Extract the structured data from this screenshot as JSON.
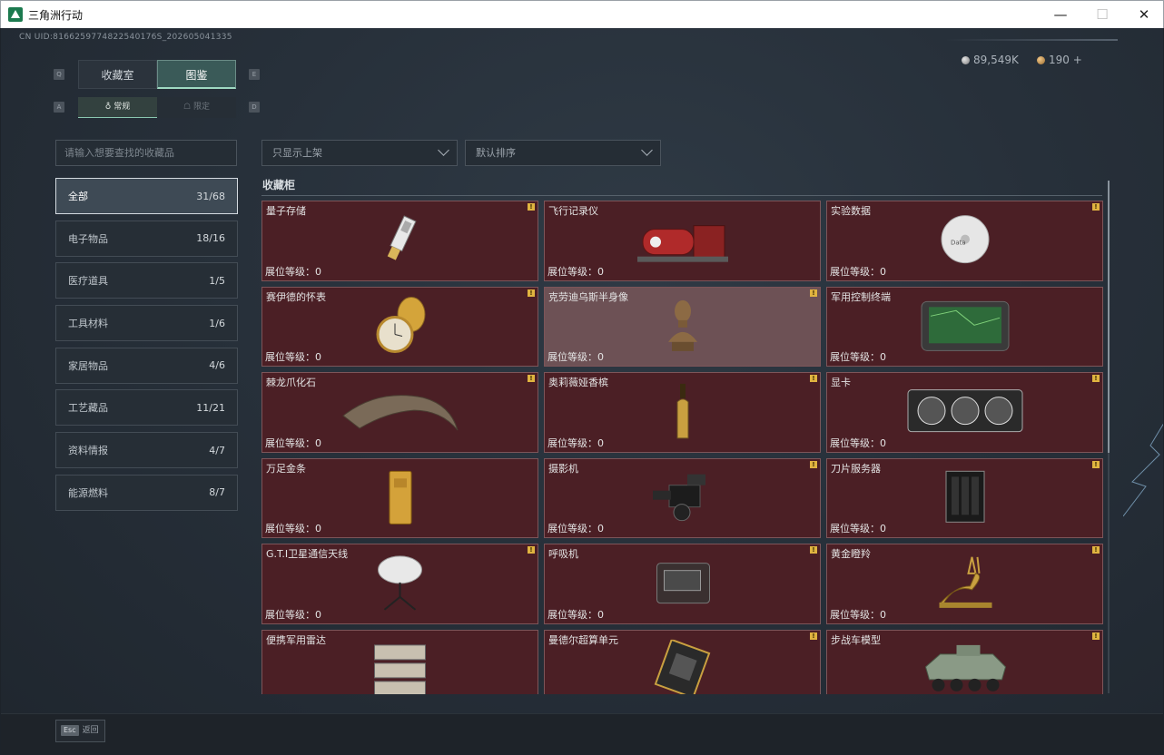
{
  "window": {
    "title": "三角洲行动",
    "minimize": "—",
    "maximize": "☐",
    "close": "✕"
  },
  "uid": "CN UID:8166259774822540176S_202605041335",
  "currency": {
    "silver": "89,549K",
    "bonds": "190 +"
  },
  "keyhints": {
    "tab_prev": "Q",
    "tab_next": "E",
    "sub_prev": "A",
    "sub_next": "D"
  },
  "tabs": [
    {
      "label": "收藏室",
      "active": false
    },
    {
      "label": "图鉴",
      "active": true
    }
  ],
  "subtabs": [
    {
      "label": "常规",
      "active": true
    },
    {
      "label": "限定",
      "active": false
    }
  ],
  "search": {
    "placeholder": "请输入想要查找的收藏品"
  },
  "filters": {
    "shelf": "只显示上架",
    "sort": "默认排序"
  },
  "categories": [
    {
      "label": "全部",
      "count": "31/68",
      "active": true
    },
    {
      "label": "电子物品",
      "count": "18/16",
      "active": false
    },
    {
      "label": "医疗道具",
      "count": "1/5",
      "active": false
    },
    {
      "label": "工具材料",
      "count": "1/6",
      "active": false
    },
    {
      "label": "家居物品",
      "count": "4/6",
      "active": false
    },
    {
      "label": "工艺藏品",
      "count": "11/21",
      "active": false
    },
    {
      "label": "资料情报",
      "count": "4/7",
      "active": false
    },
    {
      "label": "能源燃料",
      "count": "8/7",
      "active": false
    }
  ],
  "section_title": "收藏柜",
  "items": [
    {
      "name": "量子存储",
      "level": "展位等级：0",
      "badge": true,
      "icon": "usb-drive-icon"
    },
    {
      "name": "飞行记录仪",
      "level": "展位等级：0",
      "badge": false,
      "icon": "flight-recorder-icon"
    },
    {
      "name": "实验数据",
      "level": "展位等级：0",
      "badge": true,
      "icon": "disc-icon"
    },
    {
      "name": "赛伊德的怀表",
      "level": "展位等级：0",
      "badge": true,
      "icon": "pocket-watch-icon"
    },
    {
      "name": "克劳迪乌斯半身像",
      "level": "展位等级：0",
      "badge": true,
      "icon": "bust-statue-icon"
    },
    {
      "name": "军用控制终端",
      "level": "展位等级：0",
      "badge": false,
      "icon": "control-terminal-icon"
    },
    {
      "name": "棘龙爪化石",
      "level": "展位等级：0",
      "badge": true,
      "icon": "claw-fossil-icon"
    },
    {
      "name": "奥莉薇娅香槟",
      "level": "展位等级：0",
      "badge": true,
      "icon": "champagne-bottle-icon"
    },
    {
      "name": "显卡",
      "level": "展位等级：0",
      "badge": true,
      "icon": "graphics-card-icon"
    },
    {
      "name": "万足金条",
      "level": "展位等级：0",
      "badge": false,
      "icon": "gold-bar-icon"
    },
    {
      "name": "摄影机",
      "level": "展位等级：0",
      "badge": true,
      "icon": "camera-icon"
    },
    {
      "name": "刀片服务器",
      "level": "展位等级：0",
      "badge": true,
      "icon": "blade-server-icon"
    },
    {
      "name": "G.T.I卫星通信天线",
      "level": "展位等级：0",
      "badge": true,
      "icon": "satellite-dish-icon"
    },
    {
      "name": "呼吸机",
      "level": "展位等级：0",
      "badge": true,
      "icon": "ventilator-icon"
    },
    {
      "name": "黄金瞪羚",
      "level": "展位等级：0",
      "badge": true,
      "icon": "golden-gazelle-icon"
    },
    {
      "name": "便携军用雷达",
      "level": "",
      "badge": false,
      "icon": "portable-radar-icon"
    },
    {
      "name": "曼德尔超算单元",
      "level": "",
      "badge": true,
      "icon": "supercomputer-unit-icon"
    },
    {
      "name": "步战车模型",
      "level": "",
      "badge": true,
      "icon": "ifv-model-icon"
    }
  ],
  "esc": {
    "key": "Esc",
    "label": "返回"
  }
}
